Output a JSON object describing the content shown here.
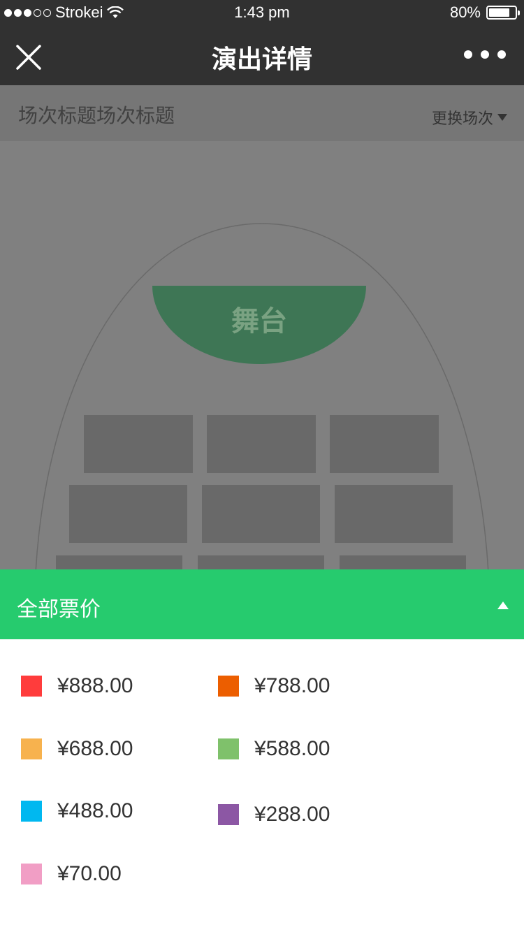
{
  "status_bar": {
    "carrier": "Strokei",
    "time": "1:43 pm",
    "battery": "80%",
    "battery_level": 0.8
  },
  "nav": {
    "title": "演出详情",
    "close_icon": "close-icon",
    "more_icon": "more-icon"
  },
  "session": {
    "title": "场次标题场次标题",
    "change_label": "更换场次"
  },
  "venue": {
    "stage_label": "舞台"
  },
  "prices": {
    "header_label": "全部票价",
    "items": [
      {
        "label": "¥888.00",
        "color": "#ff3c3c"
      },
      {
        "label": "¥788.00",
        "color": "#ec5e00"
      },
      {
        "label": "¥688.00",
        "color": "#f7b24e"
      },
      {
        "label": "¥588.00",
        "color": "#7fc16b"
      },
      {
        "label": "¥488.00",
        "color": "#00b8f0"
      },
      {
        "label": "¥288.00",
        "color": "#8c57a4"
      },
      {
        "label": "¥70.00",
        "color": "#f19ec5"
      }
    ]
  },
  "colors": {
    "accent": "#26cb6e",
    "nav_bg": "#313131"
  }
}
